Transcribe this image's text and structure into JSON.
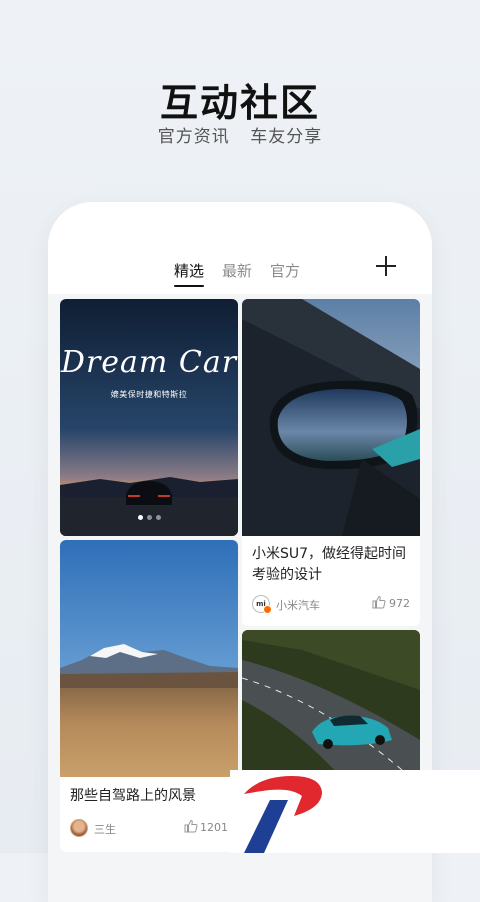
{
  "hero": {
    "title": "互动社区",
    "subtitle": "官方资讯 车友分享"
  },
  "tabs": [
    {
      "label": "精选",
      "active": true
    },
    {
      "label": "最新",
      "active": false
    },
    {
      "label": "官方",
      "active": false
    }
  ],
  "add_icon": "plus-icon",
  "cards": {
    "banner": {
      "script_text": "Dream Car",
      "subtitle": "媲美保时捷和特斯拉",
      "page_indicator": {
        "count": 3,
        "active": 1
      }
    },
    "mirror": {
      "title": "小米SU7，做经得起时间考验的设计",
      "author": "小米汽车",
      "avatar_text": "mi",
      "likes": "972"
    },
    "mountain": {
      "title": "那些自驾路上的风景",
      "author": "三生",
      "likes": "1201"
    },
    "road": {}
  },
  "colors": {
    "background": "#eef2f6",
    "accent_badge": "#ff6a00",
    "logo_red": "#e0282e",
    "logo_blue": "#1f3f95"
  }
}
